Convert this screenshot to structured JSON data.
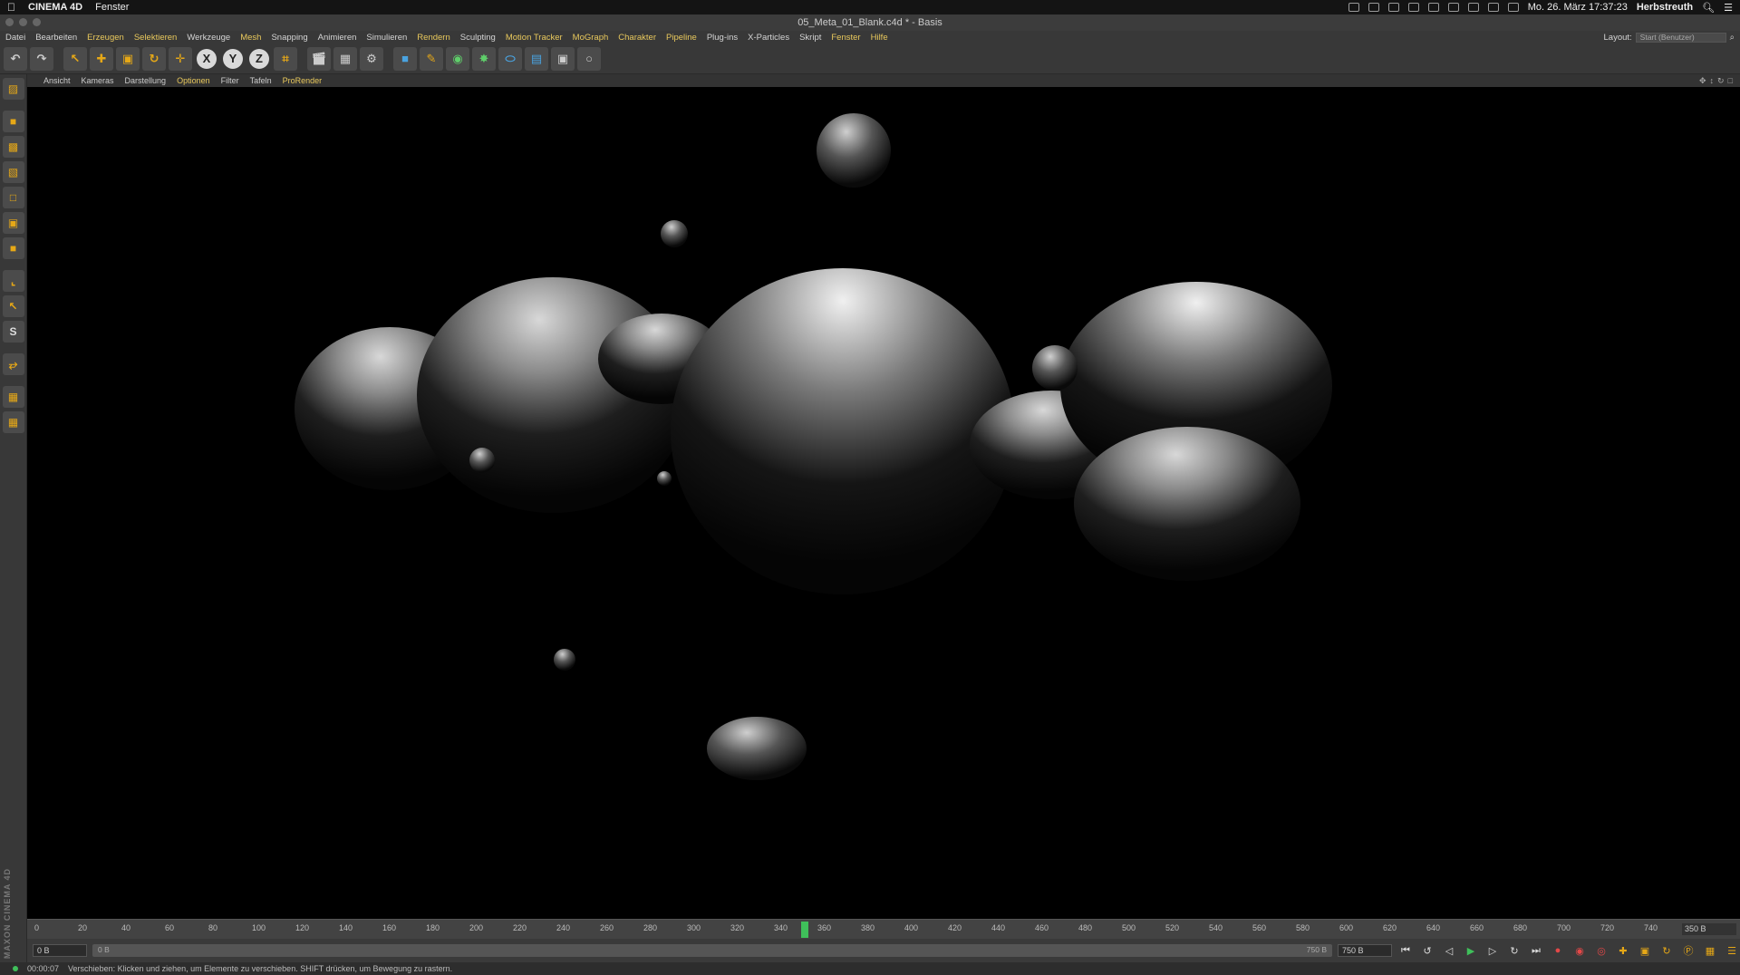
{
  "mac_menubar": {
    "app_name": "CINEMA 4D",
    "window_menu": "Fenster",
    "datetime": "Mo. 26. März  17:37:23",
    "user": "Herbstreuth"
  },
  "window": {
    "title": "05_Meta_01_Blank.c4d * - Basis"
  },
  "menu": {
    "items": [
      "Datei",
      "Bearbeiten",
      "Erzeugen",
      "Selektieren",
      "Werkzeuge",
      "Mesh",
      "Snapping",
      "Animieren",
      "Simulieren",
      "Rendern",
      "Sculpting",
      "Motion Tracker",
      "MoGraph",
      "Charakter",
      "Pipeline",
      "Plug-ins",
      "X-Particles",
      "Skript",
      "Fenster",
      "Hilfe"
    ],
    "layout_label": "Layout:",
    "layout_value": "Start (Benutzer)"
  },
  "toolbar": {
    "undo": "↶",
    "redo": "↷",
    "axis_x": "X",
    "axis_y": "Y",
    "axis_z": "Z"
  },
  "viewport_menu": {
    "items": [
      "Ansicht",
      "Kameras",
      "Darstellung",
      "Optionen",
      "Filter",
      "Tafeln",
      "ProRender"
    ]
  },
  "timeline": {
    "ticks": [
      "0",
      "20",
      "40",
      "60",
      "80",
      "100",
      "120",
      "140",
      "160",
      "180",
      "200",
      "220",
      "240",
      "260",
      "280",
      "300",
      "320",
      "340",
      "360",
      "380",
      "400",
      "420",
      "440",
      "460",
      "480",
      "500",
      "520",
      "540",
      "560",
      "580",
      "600",
      "620",
      "640",
      "660",
      "680",
      "700",
      "720",
      "740"
    ],
    "current_frame": "350",
    "end_label": "350 B"
  },
  "transport": {
    "start_field": "0 B",
    "range_start": "0 B",
    "range_end": "750 B",
    "end_field": "750 B"
  },
  "status": {
    "time": "00:00:07",
    "message": "Verschieben: Klicken und ziehen, um Elemente zu verschieben. SHIFT drücken, um Bewegung zu rastern."
  },
  "branding": {
    "logo_text": "MAXON CINEMA 4D"
  },
  "colors": {
    "accent": "#e6a817",
    "play_green": "#3fbf5a",
    "record_red": "#e34848",
    "highlight_menu": "#e8c85c"
  }
}
